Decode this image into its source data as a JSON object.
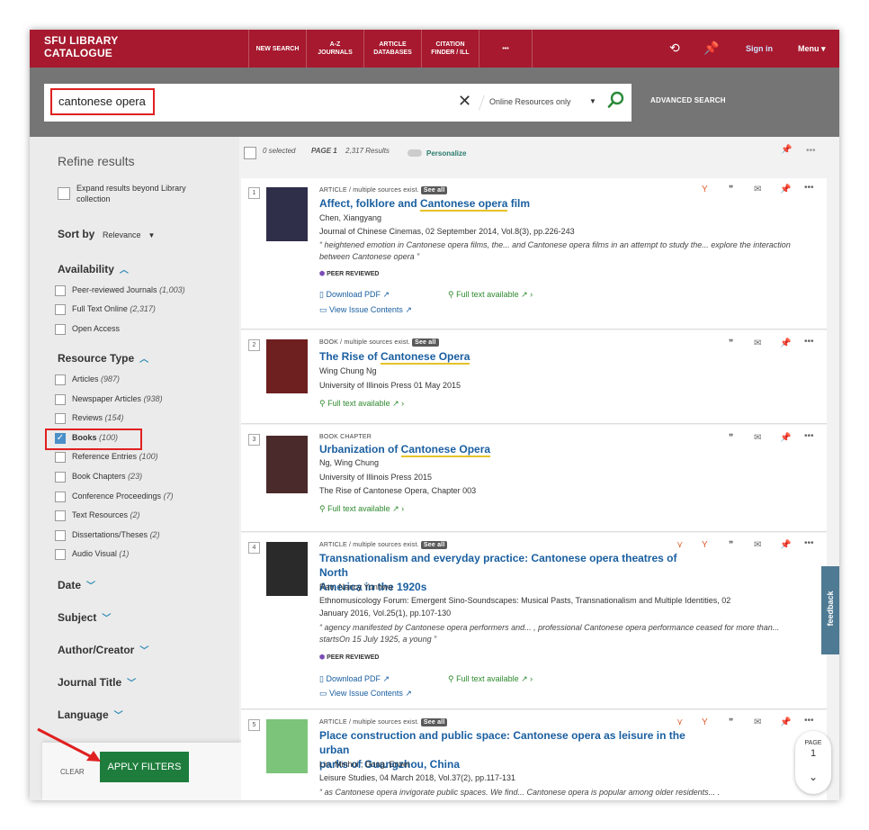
{
  "topbar": {
    "brand_line1": "SFU LIBRARY",
    "brand_line2": "CATALOGUE",
    "nav": [
      "NEW SEARCH",
      "A-Z\nJOURNALS",
      "ARTICLE\nDATABASES",
      "CITATION\nFINDER / ILL",
      "•••"
    ],
    "signin": "Sign in",
    "menu": "Menu ▾"
  },
  "search": {
    "query": "cantonese opera",
    "scope": "Online Resources only",
    "advanced": "ADVANCED SEARCH"
  },
  "filters": {
    "title": "Refine results",
    "expand_label": "Expand results beyond Library collection",
    "sort_label": "Sort by",
    "sort_value": "Relevance",
    "availability_head": "Availability",
    "availability": [
      {
        "label": "Peer-reviewed Journals",
        "count": "(1,003)"
      },
      {
        "label": "Full Text Online",
        "count": "(2,317)"
      },
      {
        "label": "Open Access",
        "count": ""
      }
    ],
    "resource_head": "Resource Type",
    "resources": [
      {
        "label": "Articles",
        "count": "(987)"
      },
      {
        "label": "Newspaper Articles",
        "count": "(938)"
      },
      {
        "label": "Reviews",
        "count": "(154)"
      },
      {
        "label": "Books",
        "count": "(100)"
      },
      {
        "label": "Reference Entries",
        "count": "(100)"
      },
      {
        "label": "Book Chapters",
        "count": "(23)"
      },
      {
        "label": "Conference Proceedings",
        "count": "(7)"
      },
      {
        "label": "Text Resources",
        "count": "(2)"
      },
      {
        "label": "Dissertations/Theses",
        "count": "(2)"
      },
      {
        "label": "Audio Visual",
        "count": "(1)"
      }
    ],
    "collapsed": [
      "Date",
      "Subject",
      "Author/Creator",
      "Journal Title",
      "Language"
    ],
    "clear": "CLEAR",
    "apply": "APPLY FILTERS"
  },
  "results_header": {
    "selected": "0 selected",
    "page": "PAGE 1",
    "count": "2,317 Results",
    "personalize": "Personalize"
  },
  "results": [
    {
      "num": "1",
      "type": "ARTICLE / multiple sources exist.",
      "see_all": "See all",
      "title_pre": "Affect, folklore and ",
      "title_hl": "Cantonese opera",
      "title_post": " film",
      "author": "Chen, Xiangyang",
      "source": "Journal of Chinese Cinemas, 02 September 2014, Vol.8(3), pp.226-243",
      "snippet": "“ heightened emotion in Cantonese opera films, the... and Cantonese opera films in an attempt to study the... explore the interaction between Cantonese opera ”",
      "peer": "PEER REVIEWED",
      "download": "Download PDF",
      "fulltext": "Full text available",
      "issue": "View Issue Contents"
    },
    {
      "num": "2",
      "type": "BOOK / multiple sources exist.",
      "see_all": "See all",
      "title_pre": "The Rise of ",
      "title_hl": "Cantonese Opera",
      "title_post": "",
      "author": "Wing Chung Ng",
      "source": "University of Illinois Press 01 May 2015",
      "fulltext": "Full text available"
    },
    {
      "num": "3",
      "type": "BOOK CHAPTER",
      "title_pre": "Urbanization of ",
      "title_hl": "Cantonese Opera",
      "title_post": "",
      "author": "Ng, Wing Chung",
      "source": "University of Illinois Press 2015",
      "source2": "The Rise of Cantonese Opera, Chapter 003",
      "fulltext": "Full text available"
    },
    {
      "num": "4",
      "type": "ARTICLE / multiple sources exist.",
      "see_all": "See all",
      "title_line1": "Transnationalism and everyday practice: Cantonese opera theatres of North",
      "title_line2": "America in the 1920s",
      "author": "Rao, Nancy Yunhwa",
      "source": "Ethnomusicology Forum: Emergent Sino-Soundscapes: Musical Pasts, Transnationalism and Multiple Identities, 02",
      "source2": "January 2016, Vol.25(1), pp.107-130",
      "snippet": "“ agency manifested by Cantonese opera performers and... , professional Cantonese opera performance ceased for more than... startsOn 15 July 1925, a young ”",
      "peer": "PEER REVIEWED",
      "download": "Download PDF",
      "fulltext": "Full text available",
      "issue": "View Issue Contents"
    },
    {
      "num": "5",
      "type": "ARTICLE / multiple sources exist.",
      "see_all": "See all",
      "title_line1": "Place construction and public space: Cantonese opera as leisure in the urban",
      "title_line2": "parks of Guangzhou, China",
      "author": "Lin, Minhui ; Dong, Erwei",
      "source": "Leisure Studies, 04 March 2018, Vol.37(2), pp.117-131",
      "snippet": "“ as Cantonese opera invigorate public spaces. We find... Cantonese opera is popular among older residents... ."
    }
  ],
  "feedback": "feedback",
  "pager": {
    "label": "PAGE",
    "num": "1"
  }
}
